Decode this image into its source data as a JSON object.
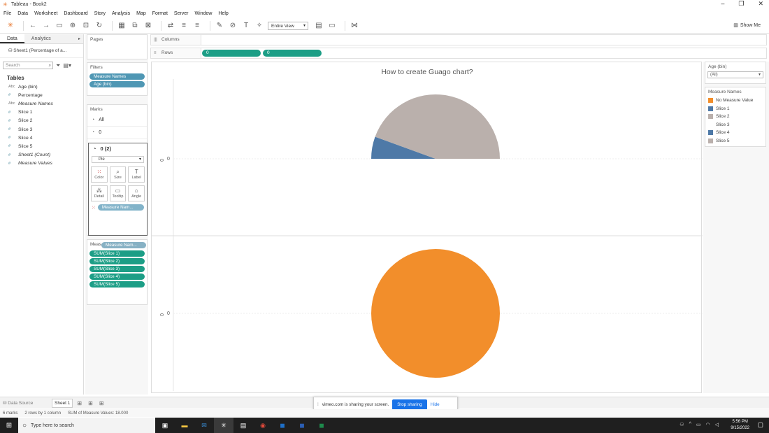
{
  "window": {
    "title": "Tableau - Book2",
    "min": "–",
    "max": "❐",
    "close": "✕"
  },
  "menu": [
    "File",
    "Data",
    "Worksheet",
    "Dashboard",
    "Story",
    "Analysis",
    "Map",
    "Format",
    "Server",
    "Window",
    "Help"
  ],
  "toolbar": {
    "view_dropdown": "Entire View",
    "show_me": "Show Me"
  },
  "left_pane": {
    "tab_data": "Data",
    "tab_analytics": "Analytics",
    "datasource": "Sheet1 (Percentage of a...",
    "search_placeholder": "Search",
    "tables_heading": "Tables",
    "fields": [
      {
        "type": "Abc",
        "name": "Age (bin)",
        "italic": false
      },
      {
        "type": "#",
        "name": "Percentage",
        "italic": false
      },
      {
        "type": "Abc",
        "name": "Measure Names",
        "italic": true
      },
      {
        "type": "#",
        "name": "Slice 1",
        "italic": false
      },
      {
        "type": "#",
        "name": "Slice 2",
        "italic": false
      },
      {
        "type": "#",
        "name": "Slice 3",
        "italic": false
      },
      {
        "type": "#",
        "name": "Slice 4",
        "italic": false
      },
      {
        "type": "#",
        "name": "Slice 5",
        "italic": false
      },
      {
        "type": "#",
        "name": "Sheet1 (Count)",
        "italic": true
      },
      {
        "type": "#",
        "name": "Measure Values",
        "italic": true
      }
    ]
  },
  "shelves": {
    "pages_title": "Pages",
    "filters_title": "Filters",
    "filters": [
      "Measure Names",
      "Age (bin)"
    ],
    "marks_title": "Marks",
    "marks_all": "All",
    "marks_zero": "0",
    "marks_zero2": "0 (2)",
    "mark_type": "Pie",
    "mark_buttons": [
      "Color",
      "Size",
      "Label",
      "Detail",
      "Tooltip",
      "Angle"
    ],
    "mark_color_pill": "Measure Nam...",
    "measure_values_title": "Meas",
    "drag_pill": "Measure Nam...",
    "measure_values": [
      "SUM(Slice 1)",
      "SUM(Slice 2)",
      "SUM(Slice 3)",
      "SUM(Slice 4)",
      "SUM(Slice 5)"
    ],
    "columns_label": "Columns",
    "rows_label": "Rows",
    "rows_pills": [
      "0",
      "0"
    ]
  },
  "chart_data": {
    "type": "pie",
    "title": "How to create Guago chart?",
    "panes": [
      {
        "axis_label": "0",
        "slices": [
          {
            "name": "Slice 4",
            "value": 1,
            "color": "#4e79a7"
          },
          {
            "name": "Slice 5",
            "value": 8,
            "color": "#bab0ac"
          },
          {
            "name": "Hidden",
            "value": 9,
            "color": "#ffffff"
          }
        ]
      },
      {
        "axis_label": "0",
        "slices": [
          {
            "name": "No Measure Value",
            "value": 1,
            "color": "#f28e2b"
          }
        ]
      }
    ]
  },
  "right_pane": {
    "agebin_title": "Age (bin)",
    "agebin_value": "(All)",
    "legend_title": "Measure Names",
    "legend": [
      {
        "name": "No Measure Value",
        "color": "#f28e2b"
      },
      {
        "name": "Slice 1",
        "color": "#4e79a7"
      },
      {
        "name": "Slice 2",
        "color": "#bab0ac"
      },
      {
        "name": "Slice 3",
        "color": "#ffffff"
      },
      {
        "name": "Slice 4",
        "color": "#4e79a7"
      },
      {
        "name": "Slice 5",
        "color": "#bab0ac"
      }
    ]
  },
  "bottom": {
    "datasource_tab": "Data Source",
    "sheet_tab": "Sheet 1",
    "share_text": "vimeo.com is sharing your screen.",
    "stop_sharing": "Stop sharing",
    "hide": "Hide",
    "status_marks": "6 marks",
    "status_rows": "2 rows by 1 column",
    "status_sum": "SUM of Measure Values: 18.000"
  },
  "taskbar": {
    "search_placeholder": "Type here to search",
    "time": "5:56 PM",
    "date": "9/15/2022"
  }
}
